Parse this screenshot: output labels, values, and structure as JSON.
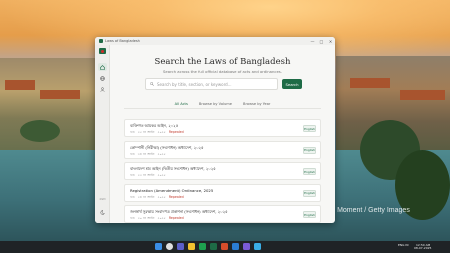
{
  "wallpaper": {
    "credit": "© Nguyen / Moment / Getty Images"
  },
  "window": {
    "app_title": "Laws of Bangladesh",
    "controls": {
      "minimize": "—",
      "maximize": "□",
      "close": "✕"
    }
  },
  "rail": {
    "items": [
      {
        "icon": "home-icon",
        "active": true
      },
      {
        "icon": "globe-icon",
        "active": false
      },
      {
        "icon": "user-icon",
        "active": false
      }
    ],
    "bottom_items": [
      {
        "label": "বাংলা"
      },
      {
        "icon": "theme-icon"
      }
    ]
  },
  "main": {
    "title": "Search the Laws of Bangladesh",
    "subtitle": "Search across the full official database of acts and ordinances.",
    "search": {
      "placeholder": "Search by title, section, or keyword...",
      "button_label": "Search"
    },
    "tabs": [
      {
        "label": "All Acts",
        "active": true
      },
      {
        "label": "Browse by Volume",
        "active": false
      },
      {
        "label": "Browse by Year",
        "active": false
      }
    ],
    "laws": [
      {
        "title": "ব্যক্তিগত আয়কর আইন, ২০২৫",
        "volume": "খণ্ড",
        "act_no": "২৫ নং আইন",
        "year": "২০২৫",
        "status": "Repealed",
        "action": "English"
      },
      {
        "title": "কোম্পানী (নিরীক্ষা) (সংশোধন) অধ্যাদেশ, ২০২৫",
        "volume": "খণ্ড",
        "act_no": "৩৪ নং আইন",
        "year": "২০২৫",
        "status": "",
        "action": "English"
      },
      {
        "title": "বাংলাদেশ শ্রম আইন (দ্বিতীয় সংশোধন) অধ্যাদেশ, ২০২৫",
        "volume": "খণ্ড",
        "act_no": "২২ নং আইন",
        "year": "২০২৫",
        "status": "",
        "action": "English"
      },
      {
        "title": "Registration (Amendment) Ordinance, 2025",
        "volume": "খণ্ড",
        "act_no": "২৪ নং আইন",
        "year": "২০২৫",
        "status": "Repealed",
        "action": "English"
      },
      {
        "title": "জনস্বার্থ সুরক্ষায় সংবাদপত্র প্রকাশনা (সংশোধন) অধ্যাদেশ, ২০২৫",
        "volume": "খণ্ড",
        "act_no": "২০ নং আইন",
        "year": "২০২৫",
        "status": "Repealed",
        "action": "English"
      }
    ]
  },
  "taskbar": {
    "tray_left": "ENG\nIN",
    "clock_time": "12:50 AM",
    "clock_date": "08-07-2025"
  }
}
